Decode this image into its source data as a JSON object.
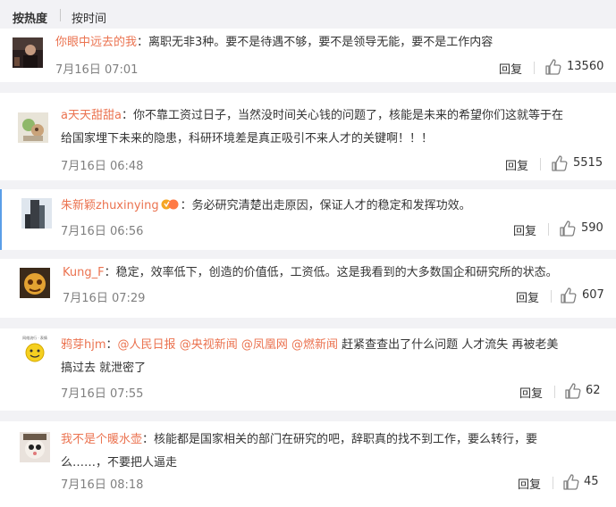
{
  "sort": {
    "hot": "按热度",
    "time": "按时间"
  },
  "comments": [
    {
      "user": "你眼中远去的我",
      "colon": "：",
      "text": "离职无非3种。要不是待遇不够，要不是领导无能，要不是工作内容",
      "time": "7月16日 07:01",
      "reply": "回复",
      "likes": "13560"
    },
    {
      "user": "a天天甜甜a",
      "colon": "：",
      "text1": "你不靠工资过日子，当然没时间关心钱的问题了，核能是未来的希望你们这就等于在",
      "text2": "给国家埋下未来的隐患，科研环境差是真正吸引不来人才的关键啊！！！",
      "time": "7月16日 06:48",
      "reply": "回复",
      "likes": "5515"
    },
    {
      "user": "朱新颖zhuxinying",
      "colon": "：",
      "text": "务必研究清楚出走原因，保证人才的稳定和发挥功效。",
      "time": "7月16日 06:56",
      "reply": "回复",
      "likes": "590"
    },
    {
      "user": "Kung_F",
      "colon": "：",
      "text": "稳定，效率低下，创造的价值低，工资低。这是我看到的大多数国企和研究所的状态。",
      "time": "7月16日 07:29",
      "reply": "回复",
      "likes": "607"
    },
    {
      "user": "鸦芽hjm",
      "colon": "：",
      "m1": "@人民日报",
      "m2": "@央视新闻",
      "m3": "@凤凰网",
      "m4": "@燃新闻",
      "text1": " 赶紧查查出了什么问题 人才流失 再被老美",
      "text2": "搞过去 就泄密了",
      "avatar_text": "网络流行 · 表情",
      "time": "7月16日 07:55",
      "reply": "回复",
      "likes": "62"
    },
    {
      "user": "我不是个暖水壶",
      "colon": "：",
      "text1": "核能都是国家相关的部门在研究的吧，辞职真的找不到工作，要么转行，要",
      "text2": "么……，不要把人逼走",
      "time": "7月16日 08:18",
      "reply": "回复",
      "likes": "45"
    }
  ],
  "colors": {
    "username": "#eb7350",
    "highlight_border": "#5a9ee8",
    "page_bg": "#f2f2f5"
  }
}
